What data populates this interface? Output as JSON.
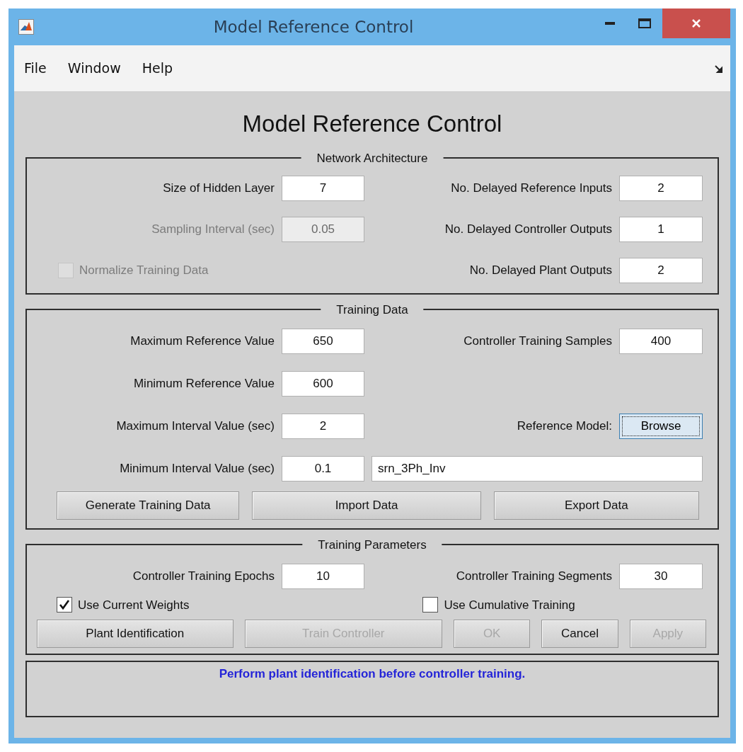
{
  "window": {
    "title": "Model Reference Control"
  },
  "menu": [
    "File",
    "Window",
    "Help"
  ],
  "heading": "Model Reference Control",
  "network_architecture": {
    "title": "Network Architecture",
    "left_fields": [
      {
        "label": "Size of Hidden Layer",
        "value": "7",
        "disabled": false
      },
      {
        "label": "Sampling Interval (sec)",
        "value": "0.05",
        "disabled": true
      }
    ],
    "right_fields": [
      {
        "label": "No. Delayed Reference Inputs",
        "value": "2",
        "disabled": false
      },
      {
        "label": "No. Delayed Controller Outputs",
        "value": "1",
        "disabled": false
      },
      {
        "label": "No. Delayed Plant Outputs",
        "value": "2",
        "disabled": false
      }
    ],
    "normalize": {
      "label": "Normalize Training Data",
      "checked": false,
      "disabled": true
    }
  },
  "training_data": {
    "title": "Training Data",
    "left_fields": [
      {
        "label": "Maximum Reference Value",
        "value": "650",
        "disabled": false
      },
      {
        "label": "Minimum Reference Value",
        "value": "600",
        "disabled": false
      },
      {
        "label": "Maximum Interval Value (sec)",
        "value": "2",
        "disabled": false
      },
      {
        "label": "Minimum Interval Value (sec)",
        "value": "0.1",
        "disabled": false
      }
    ],
    "right_fields": [
      {
        "label": "Controller Training Samples",
        "value": "400",
        "disabled": false
      }
    ],
    "reference_model": {
      "label": "Reference Model:",
      "button": "Browse",
      "value": "srn_3Ph_Inv"
    },
    "buttons": [
      {
        "label": "Generate Training Data",
        "disabled": false
      },
      {
        "label": "Import Data",
        "disabled": false
      },
      {
        "label": "Export Data",
        "disabled": false
      }
    ]
  },
  "training_parameters": {
    "title": "Training Parameters",
    "fields": [
      {
        "label": "Controller Training Epochs",
        "value": "10",
        "disabled": false
      },
      {
        "label": "Controller Training Segments",
        "value": "30",
        "disabled": false
      }
    ],
    "checkboxes": [
      {
        "label": "Use Current Weights",
        "checked": true,
        "disabled": false
      },
      {
        "label": "Use Cumulative Training",
        "checked": false,
        "disabled": false
      }
    ],
    "buttons": [
      {
        "label": "Plant Identification",
        "disabled": false
      },
      {
        "label": "Train Controller",
        "disabled": true
      },
      {
        "label": "OK",
        "disabled": true
      },
      {
        "label": "Cancel",
        "disabled": false
      },
      {
        "label": "Apply",
        "disabled": true
      }
    ]
  },
  "status": "Perform plant identification before controller training."
}
